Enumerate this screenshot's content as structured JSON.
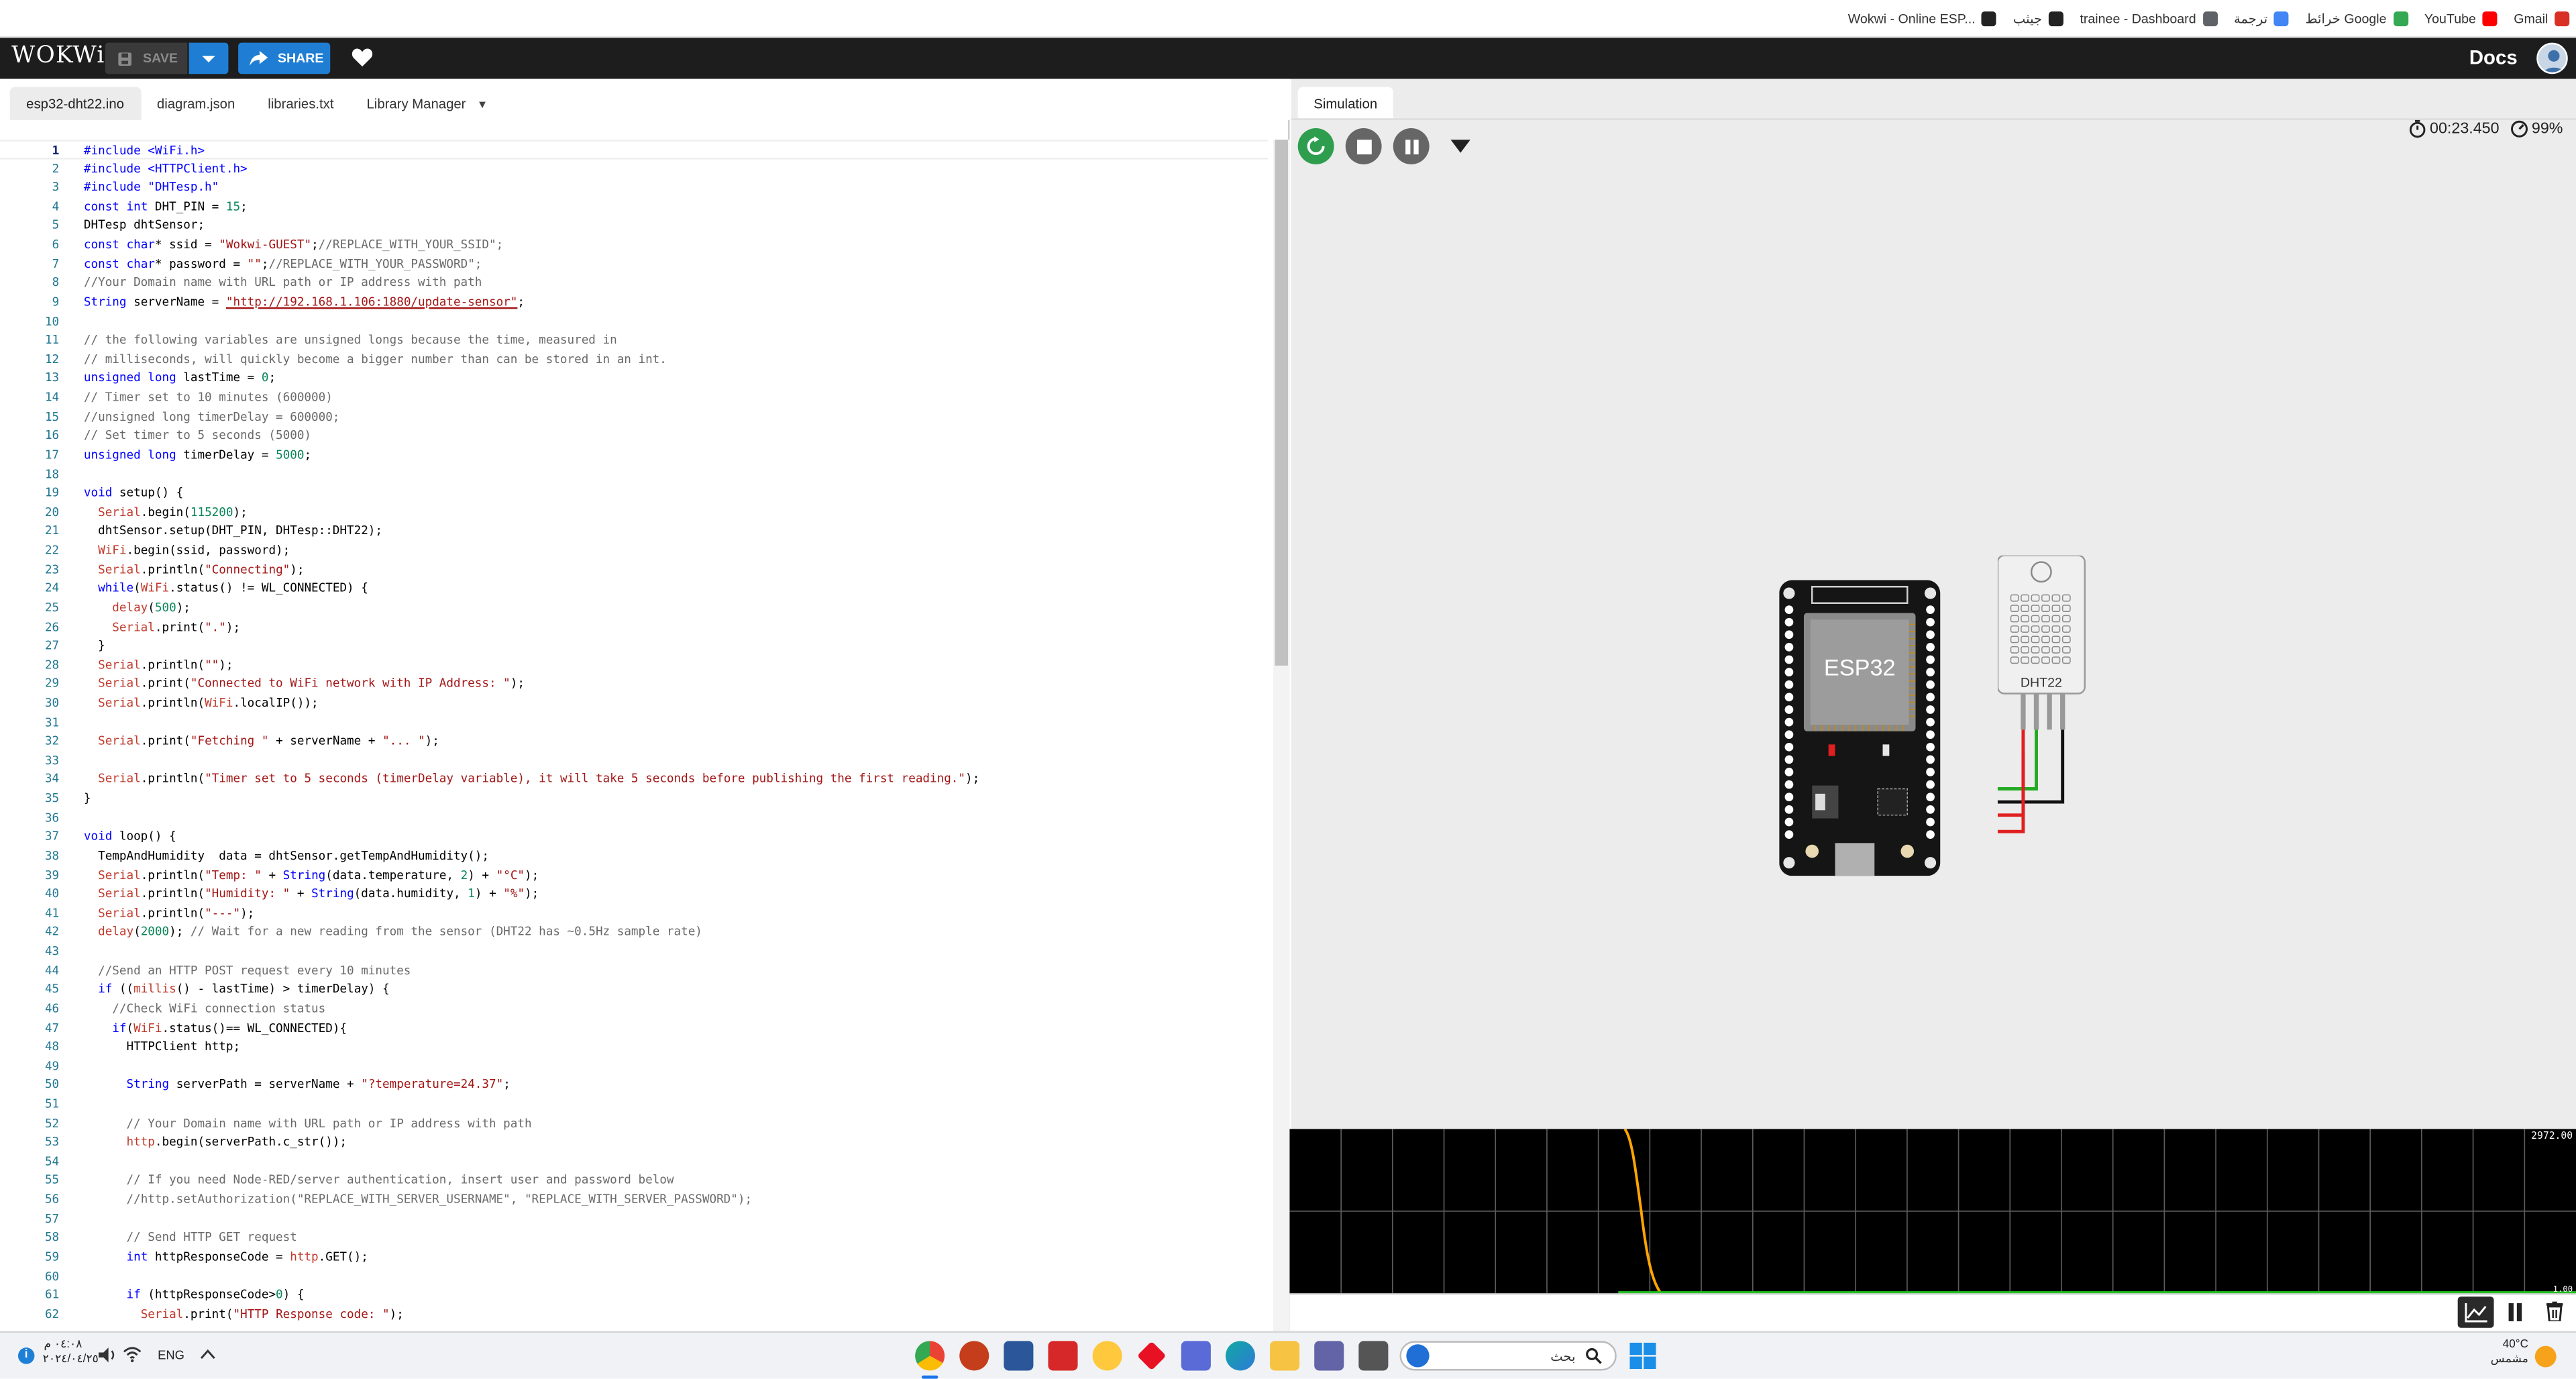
{
  "browser": {
    "bookmarks": [
      {
        "label": "Gmail",
        "icon": "gmail-icon",
        "color": "#d93025"
      },
      {
        "label": "YouTube",
        "icon": "youtube-icon",
        "color": "#ff0000"
      },
      {
        "label": "خرائط Google",
        "icon": "maps-icon",
        "color": "#34a853"
      },
      {
        "label": "ترجمة",
        "icon": "translate-icon",
        "color": "#4285f4"
      },
      {
        "label": "trainee - Dashboard",
        "icon": "globe-icon",
        "color": "#5f6368"
      },
      {
        "label": "جيثب",
        "icon": "github-icon",
        "color": "#222222"
      },
      {
        "label": "Wokwi - Online ESP...",
        "icon": "wikipedia-icon",
        "color": "#222222"
      }
    ]
  },
  "header": {
    "logo": "WOKWi",
    "save_label": "SAVE",
    "share_label": "SHARE",
    "docs_label": "Docs"
  },
  "editor": {
    "tabs": [
      "esp32-dht22.ino",
      "diagram.json",
      "libraries.txt",
      "Library Manager"
    ],
    "active_tab": 0,
    "lines": [
      "#include <WiFi.h>",
      "#include <HTTPClient.h>",
      "#include \"DHTesp.h\"",
      "const int DHT_PIN = 15;",
      "DHTesp dhtSensor;",
      "const char* ssid = \"Wokwi-GUEST\";//REPLACE_WITH_YOUR_SSID\";",
      "const char* password = \"\";//REPLACE_WITH_YOUR_PASSWORD\";",
      "//Your Domain name with URL path or IP address with path",
      "String serverName = \"http://192.168.1.106:1880/update-sensor\";",
      "",
      "// the following variables are unsigned longs because the time, measured in",
      "// milliseconds, will quickly become a bigger number than can be stored in an int.",
      "unsigned long lastTime = 0;",
      "// Timer set to 10 minutes (600000)",
      "//unsigned long timerDelay = 600000;",
      "// Set timer to 5 seconds (5000)",
      "unsigned long timerDelay = 5000;",
      "",
      "void setup() {",
      "  Serial.begin(115200);",
      "  dhtSensor.setup(DHT_PIN, DHTesp::DHT22);",
      "  WiFi.begin(ssid, password);",
      "  Serial.println(\"Connecting\");",
      "  while(WiFi.status() != WL_CONNECTED) {",
      "    delay(500);",
      "    Serial.print(\".\");",
      "  }",
      "  Serial.println(\"\");",
      "  Serial.print(\"Connected to WiFi network with IP Address: \");",
      "  Serial.println(WiFi.localIP());",
      "",
      "  Serial.print(\"Fetching \" + serverName + \"... \");",
      "",
      "  Serial.println(\"Timer set to 5 seconds (timerDelay variable), it will take 5 seconds before publishing the first reading.\");",
      "}",
      "",
      "void loop() {",
      "  TempAndHumidity  data = dhtSensor.getTempAndHumidity();",
      "  Serial.println(\"Temp: \" + String(data.temperature, 2) + \"°C\");",
      "  Serial.println(\"Humidity: \" + String(data.humidity, 1) + \"%\");",
      "  Serial.println(\"---\");",
      "  delay(2000); // Wait for a new reading from the sensor (DHT22 has ~0.5Hz sample rate)",
      "",
      "  //Send an HTTP POST request every 10 minutes",
      "  if ((millis() - lastTime) > timerDelay) {",
      "    //Check WiFi connection status",
      "    if(WiFi.status()== WL_CONNECTED){",
      "      HTTPClient http;",
      "",
      "      String serverPath = serverName + \"?temperature=24.37\";",
      "",
      "      // Your Domain name with URL path or IP address with path",
      "      http.begin(serverPath.c_str());",
      "",
      "      // If you need Node-RED/server authentication, insert user and password below",
      "      //http.setAuthorization(\"REPLACE_WITH_SERVER_USERNAME\", \"REPLACE_WITH_SERVER_PASSWORD\");",
      "",
      "      // Send HTTP GET request",
      "      int httpResponseCode = http.GET();",
      "",
      "      if (httpResponseCode>0) {",
      "        Serial.print(\"HTTP Response code: \");"
    ]
  },
  "simulation": {
    "tab_label": "Simulation",
    "timer": "00:23.450",
    "performance": "99%",
    "board_label": "ESP32",
    "sensor_label": "DHT22"
  },
  "plotter": {
    "y_max": "2972.00",
    "y_min": "1.00",
    "accent": "#ffa500",
    "baseline": "#22c022"
  },
  "taskbar": {
    "search_placeholder": "بحث",
    "lang": "ENG",
    "time": "٠٤:٠٨ م",
    "date": "٢٠٢٤/٠٤/٢٥",
    "weather_temp": "40°C",
    "weather_desc": "مشمس"
  }
}
